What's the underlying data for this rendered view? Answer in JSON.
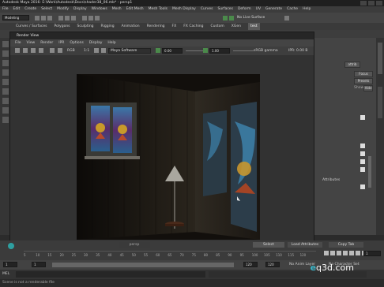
{
  "window": {
    "title": "Autodesk Maya 2016: E:\\Work\\Autodesk\\Docs\\shader38_06.mb* - persp1"
  },
  "menubar": [
    "File",
    "Edit",
    "Create",
    "Select",
    "Modify",
    "Display",
    "Windows",
    "Mesh",
    "Edit Mesh",
    "Mesh Tools",
    "Mesh Display",
    "Curves",
    "Surfaces",
    "Deform",
    "UV",
    "Generate",
    "Cache",
    "Help"
  ],
  "statusline": {
    "mode": "Modeling",
    "live_surface": "No Live Surface"
  },
  "shelf_tabs": [
    "Curves / Surfaces",
    "Polygons",
    "Sculpting",
    "Rigging",
    "Animation",
    "Rendering",
    "FX",
    "FX Caching",
    "Custom",
    "XGen",
    "test"
  ],
  "active_shelf_tab": "test",
  "render_view": {
    "title": "Render View",
    "menu": [
      "File",
      "View",
      "Render",
      "IPR",
      "Options",
      "Display",
      "Help"
    ],
    "renderer": "Maya Software",
    "zoom": "1:1",
    "exposure": "0.00",
    "gamma": "1.00",
    "color_space": "sRGB gamma",
    "ipr_status": "IPR: 0.00 B",
    "caption": "size: 640 x 480 zoom: 1.000 (raytrace,shadowMM,fps)"
  },
  "right_panel": {
    "tab": "attrib",
    "buttons": [
      "Focus",
      "Presets",
      "Show",
      "Hide"
    ],
    "section": "Attributes"
  },
  "timeline": {
    "ticks": [
      "5",
      "10",
      "15",
      "20",
      "25",
      "30",
      "35",
      "40",
      "45",
      "50",
      "55",
      "60",
      "65",
      "70",
      "75",
      "80",
      "85",
      "90",
      "95",
      "100",
      "105",
      "110",
      "115",
      "120"
    ],
    "current": "1"
  },
  "range": {
    "start": "1",
    "inner_start": "1",
    "inner_end": "120",
    "end": "120",
    "anim_layer": "No Anim Layer",
    "char_set": "No Character Set"
  },
  "cmd": {
    "label": "MEL"
  },
  "help_line": "Scene is not a renderable file"
}
